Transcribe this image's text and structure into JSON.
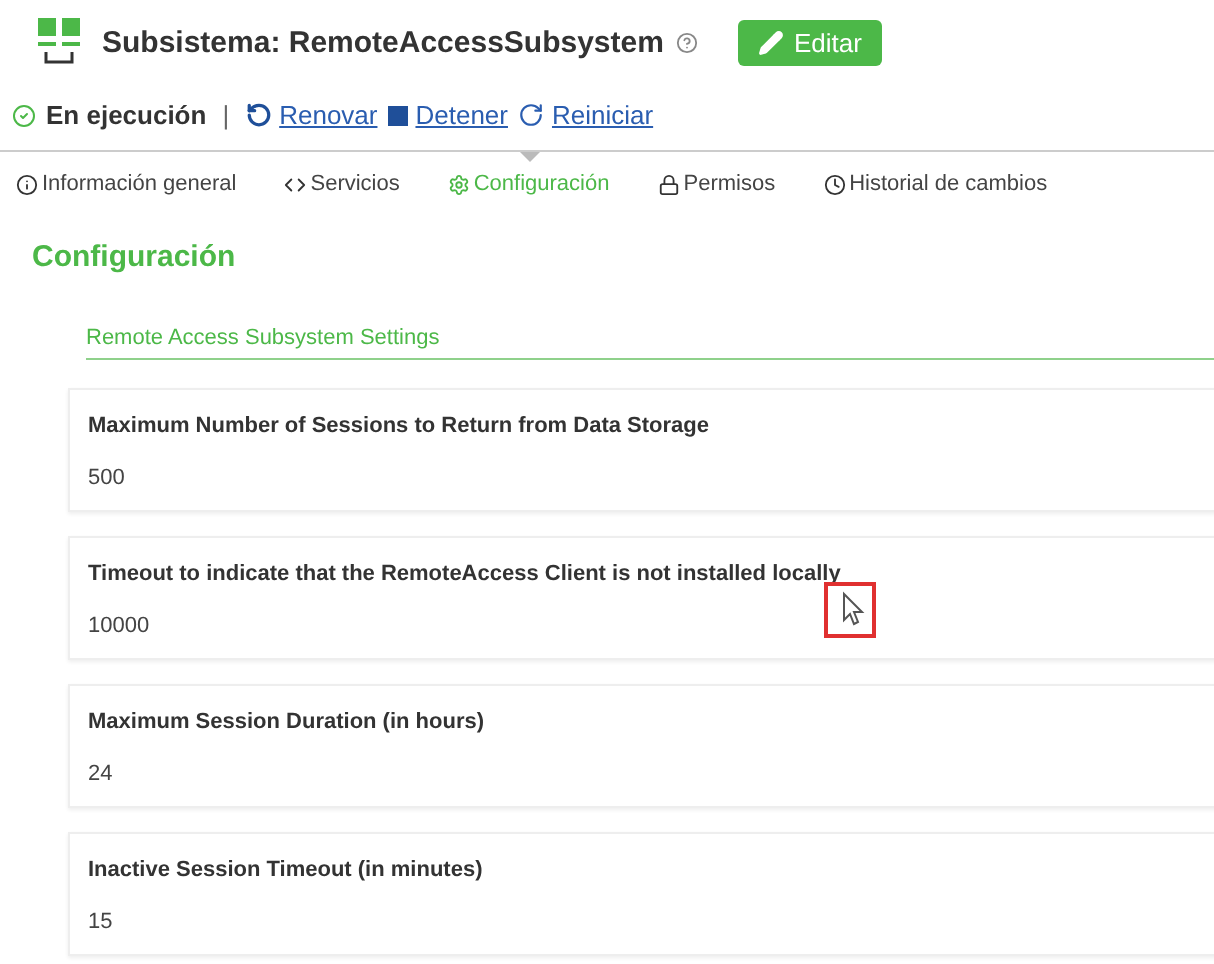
{
  "header": {
    "title": "Subsistema: RemoteAccessSubsystem",
    "edit_button": "Editar"
  },
  "status": {
    "label": "En ejecución",
    "separator": "|",
    "actions": [
      {
        "kind": "refresh",
        "label": "Renovar"
      },
      {
        "kind": "stop",
        "label": "Detener"
      },
      {
        "kind": "restart",
        "label": "Reiniciar"
      }
    ]
  },
  "tabs": [
    {
      "kind": "info",
      "label": "Información general",
      "selected": false
    },
    {
      "kind": "code",
      "label": "Servicios",
      "selected": false
    },
    {
      "kind": "gear",
      "label": "Configuración",
      "selected": true
    },
    {
      "kind": "lock",
      "label": "Permisos",
      "selected": false
    },
    {
      "kind": "clock",
      "label": "Historial de cambios",
      "selected": false
    }
  ],
  "section": {
    "heading": "Configuración",
    "group_title": "Remote Access Subsystem Settings"
  },
  "settings": [
    {
      "label": "Maximum Number of Sessions to Return from Data Storage",
      "value": "500"
    },
    {
      "label": "Timeout to indicate that the RemoteAccess Client is not installed locally",
      "value": "10000"
    },
    {
      "label": "Maximum Session Duration (in hours)",
      "value": "24"
    },
    {
      "label": "Inactive Session Timeout (in minutes)",
      "value": "15"
    }
  ]
}
